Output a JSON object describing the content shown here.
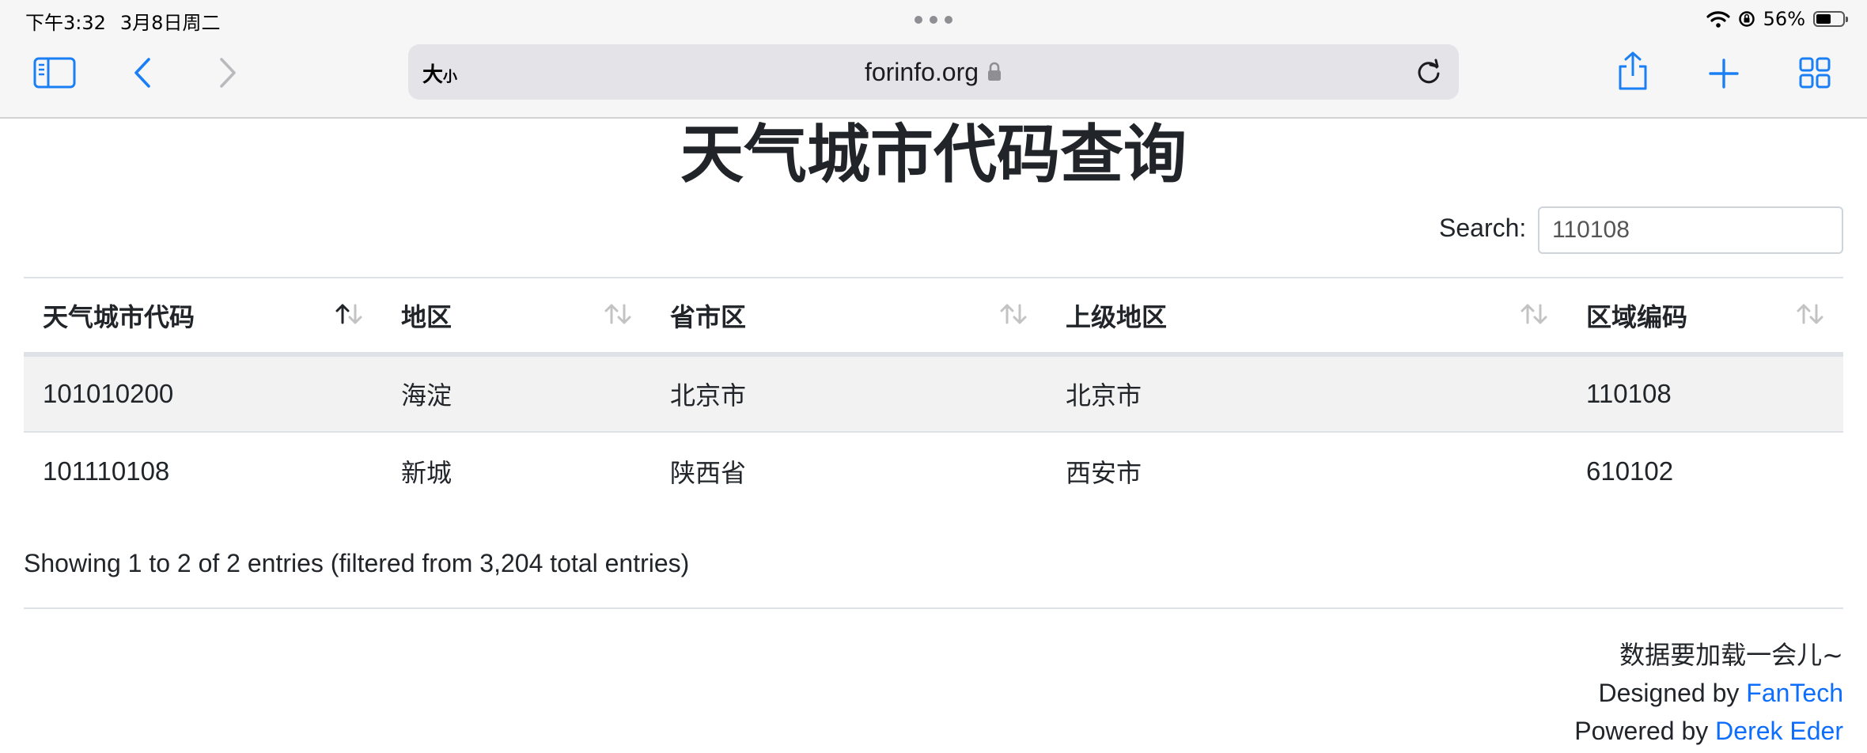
{
  "status": {
    "time": "下午3:32",
    "date": "3月8日周二",
    "battery_percent": "56%",
    "battery_level": 0.56
  },
  "browser": {
    "reader_label_big": "大",
    "reader_label_small": "小",
    "url": "forinfo.org",
    "icons": [
      "sidebar-icon",
      "back-icon",
      "forward-icon",
      "lock-icon",
      "reload-icon",
      "share-icon",
      "new-tab-icon",
      "tabs-overview-icon"
    ]
  },
  "page": {
    "title": "天气城市代码查询",
    "search_label": "Search:",
    "search_value": "110108",
    "table": {
      "columns": [
        "天气城市代码",
        "地区",
        "省市区",
        "上级地区",
        "区域编码"
      ],
      "sorted_column": 0,
      "rows": [
        [
          "101010200",
          "海淀",
          "北京市",
          "北京市",
          "110108"
        ],
        [
          "101110108",
          "新城",
          "陕西省",
          "西安市",
          "610102"
        ]
      ]
    },
    "info": "Showing 1 to 2 of 2 entries (filtered from 3,204 total entries)",
    "footer": {
      "loading_note": "数据要加载一会儿~",
      "designed_prefix": "Designed by ",
      "designed_link": "FanTech",
      "powered_prefix": "Powered by ",
      "powered_link": "Derek Eder"
    }
  },
  "colors": {
    "link": "#0d6efd",
    "toolbar_icon": "#1a7ff5",
    "striped_row": "#f2f2f2"
  }
}
